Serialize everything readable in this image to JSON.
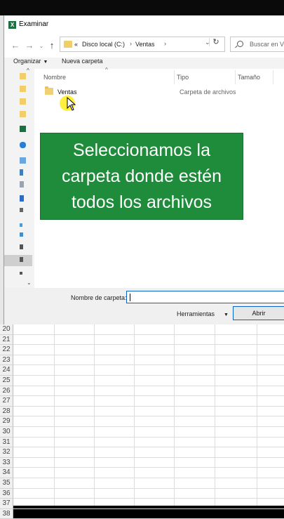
{
  "dialog": {
    "title": "Examinar",
    "app_icon": "excel-icon",
    "nav": {
      "back_icon": "arrow-left-icon",
      "forward_icon": "arrow-right-icon",
      "up_icon": "arrow-up-icon",
      "dropdown_icon": "chevron-down-icon"
    },
    "address": {
      "overflow": "«",
      "parts": [
        "Disco local (C:)",
        "Ventas"
      ],
      "separator": "›",
      "dropdown": "⌄"
    },
    "refresh_icon": "refresh-icon",
    "search": {
      "placeholder": "Buscar en Ventas"
    },
    "toolbar": {
      "organize": "Organizar",
      "new_folder": "Nueva carpeta"
    },
    "columns": {
      "name": "Nombre",
      "type": "Tipo",
      "size": "Tamaño"
    },
    "files": [
      {
        "name": "Ventas",
        "type": "Carpeta de archivos"
      }
    ],
    "bottom": {
      "folder_label": "Nombre de carpeta:",
      "folder_value": "",
      "tools_label": "Herramientas",
      "open_label": "Abrir"
    }
  },
  "overlay": {
    "text": "Seleccionamos la carpeta donde estén todos los archivos",
    "background": "#1e8c3a"
  },
  "sheet": {
    "rows": [
      20,
      21,
      22,
      23,
      24,
      25,
      26,
      27,
      28,
      29,
      30,
      31,
      32,
      33,
      34,
      35,
      36,
      37,
      38
    ]
  }
}
